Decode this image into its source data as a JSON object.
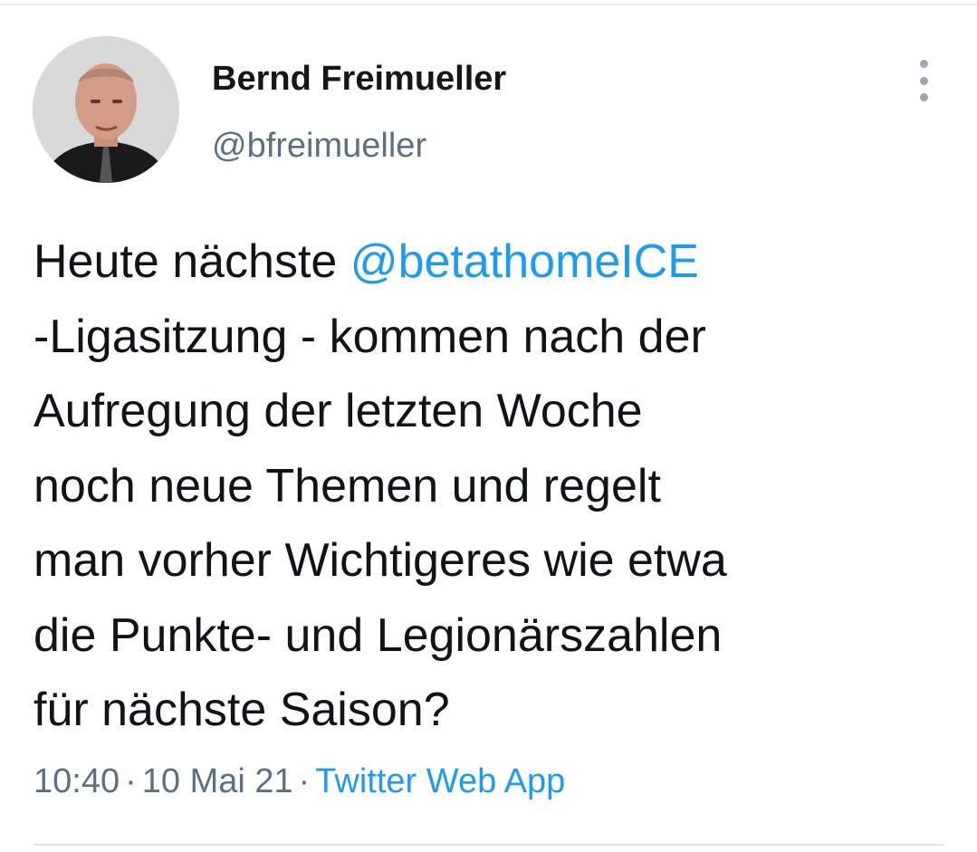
{
  "author": {
    "display_name": "Bernd Freimueller",
    "handle": "@bfreimueller"
  },
  "tweet": {
    "line1_prefix": "Heute nächste ",
    "mention": "@betathomeICE",
    "lines": [
      "-Ligasitzung - kommen nach der",
      "Aufregung der letzten Woche",
      "noch neue Themen und regelt",
      "man vorher Wichtigeres wie etwa",
      "die Punkte- und Legionärszahlen",
      "für nächste Saison?"
    ]
  },
  "meta": {
    "time": "10:40",
    "separator": "·",
    "date": "10 Mai 21",
    "source": "Twitter Web App"
  },
  "icons": {
    "more": "more-vertical-icon"
  },
  "colors": {
    "link": "#1d9bf0",
    "secondary_text": "#5b7083",
    "primary_text": "#0f1419"
  }
}
